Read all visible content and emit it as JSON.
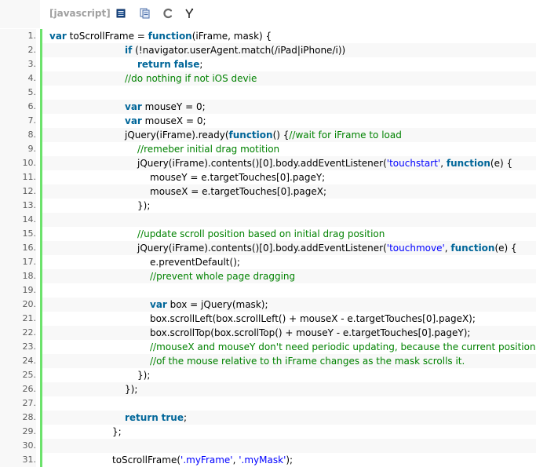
{
  "toolbar": {
    "language": "[javascript]",
    "icons": [
      "view-source-icon",
      "copy-icon",
      "print-icon",
      "about-icon"
    ]
  },
  "colors": {
    "keyword": "#006699",
    "string": "#0000ff",
    "comment": "#008200",
    "gutter_bar": "#6ce26c",
    "line_number": "#5c5c5c"
  },
  "code": {
    "lines": [
      {
        "num": "1.",
        "indent": 0,
        "tokens": [
          [
            "kw",
            "var"
          ],
          [
            "p",
            " toScrollFrame = "
          ],
          [
            "kw",
            "function"
          ],
          [
            "p",
            "(iFrame, mask) {"
          ]
        ]
      },
      {
        "num": "2.",
        "indent": 6,
        "tokens": [
          [
            "kw",
            "if"
          ],
          [
            "p",
            " (!navigator.userAgent.match(/iPad|iPhone/i))"
          ]
        ]
      },
      {
        "num": "3.",
        "indent": 7,
        "tokens": [
          [
            "kw",
            "return"
          ],
          [
            "p",
            " "
          ],
          [
            "kw",
            "false"
          ],
          [
            "p",
            ";"
          ]
        ]
      },
      {
        "num": "4.",
        "indent": 6,
        "tokens": [
          [
            "c",
            "//do nothing if not iOS devie"
          ]
        ]
      },
      {
        "num": "5.",
        "indent": 0,
        "tokens": []
      },
      {
        "num": "6.",
        "indent": 6,
        "tokens": [
          [
            "kw",
            "var"
          ],
          [
            "p",
            " mouseY = 0;"
          ]
        ]
      },
      {
        "num": "7.",
        "indent": 6,
        "tokens": [
          [
            "kw",
            "var"
          ],
          [
            "p",
            " mouseX = 0;"
          ]
        ]
      },
      {
        "num": "8.",
        "indent": 6,
        "tokens": [
          [
            "p",
            "jQuery(iFrame).ready("
          ],
          [
            "kw",
            "function"
          ],
          [
            "p",
            "() {"
          ],
          [
            "c",
            "//wait for iFrame to load"
          ]
        ]
      },
      {
        "num": "9.",
        "indent": 7,
        "tokens": [
          [
            "c",
            "//remeber initial drag motition"
          ]
        ]
      },
      {
        "num": "10.",
        "indent": 7,
        "tokens": [
          [
            "p",
            "jQuery(iFrame).contents()[0].body.addEventListener("
          ],
          [
            "s",
            "'touchstart'"
          ],
          [
            "p",
            ", "
          ],
          [
            "kw",
            "function"
          ],
          [
            "p",
            "(e) {"
          ]
        ]
      },
      {
        "num": "11.",
        "indent": 8,
        "tokens": [
          [
            "p",
            "mouseY = e.targetTouches[0].pageY;"
          ]
        ]
      },
      {
        "num": "12.",
        "indent": 8,
        "tokens": [
          [
            "p",
            "mouseX = e.targetTouches[0].pageX;"
          ]
        ]
      },
      {
        "num": "13.",
        "indent": 7,
        "tokens": [
          [
            "p",
            "});"
          ]
        ]
      },
      {
        "num": "14.",
        "indent": 0,
        "tokens": []
      },
      {
        "num": "15.",
        "indent": 7,
        "tokens": [
          [
            "c",
            "//update scroll position based on initial drag position"
          ]
        ]
      },
      {
        "num": "16.",
        "indent": 7,
        "tokens": [
          [
            "p",
            "jQuery(iFrame).contents()[0].body.addEventListener("
          ],
          [
            "s",
            "'touchmove'"
          ],
          [
            "p",
            ", "
          ],
          [
            "kw",
            "function"
          ],
          [
            "p",
            "(e) {"
          ]
        ]
      },
      {
        "num": "17.",
        "indent": 8,
        "tokens": [
          [
            "p",
            "e.preventDefault();"
          ]
        ]
      },
      {
        "num": "18.",
        "indent": 8,
        "tokens": [
          [
            "c",
            "//prevent whole page dragging"
          ]
        ]
      },
      {
        "num": "19.",
        "indent": 0,
        "tokens": []
      },
      {
        "num": "20.",
        "indent": 8,
        "tokens": [
          [
            "kw",
            "var"
          ],
          [
            "p",
            " box = jQuery(mask);"
          ]
        ]
      },
      {
        "num": "21.",
        "indent": 8,
        "tokens": [
          [
            "p",
            "box.scrollLeft(box.scrollLeft() + mouseX - e.targetTouches[0].pageX);"
          ]
        ]
      },
      {
        "num": "22.",
        "indent": 8,
        "tokens": [
          [
            "p",
            "box.scrollTop(box.scrollTop() + mouseY - e.targetTouches[0].pageY);"
          ]
        ]
      },
      {
        "num": "23.",
        "indent": 8,
        "tokens": [
          [
            "c",
            "//mouseX and mouseY don't need periodic updating, because the current position"
          ]
        ]
      },
      {
        "num": "24.",
        "indent": 8,
        "tokens": [
          [
            "c",
            "//of the mouse relative to th iFrame changes as the mask scrolls it."
          ]
        ]
      },
      {
        "num": "25.",
        "indent": 7,
        "tokens": [
          [
            "p",
            "});"
          ]
        ]
      },
      {
        "num": "26.",
        "indent": 6,
        "tokens": [
          [
            "p",
            "});"
          ]
        ]
      },
      {
        "num": "27.",
        "indent": 0,
        "tokens": []
      },
      {
        "num": "28.",
        "indent": 6,
        "tokens": [
          [
            "kw",
            "return"
          ],
          [
            "p",
            " "
          ],
          [
            "kw",
            "true"
          ],
          [
            "p",
            ";"
          ]
        ]
      },
      {
        "num": "29.",
        "indent": 5,
        "tokens": [
          [
            "p",
            "};"
          ]
        ]
      },
      {
        "num": "30.",
        "indent": 0,
        "tokens": []
      },
      {
        "num": "31.",
        "indent": 5,
        "tokens": [
          [
            "p",
            "toScrollFrame("
          ],
          [
            "s",
            "'.myFrame'"
          ],
          [
            "p",
            ", "
          ],
          [
            "s",
            "'.myMask'"
          ],
          [
            "p",
            ");"
          ]
        ]
      }
    ]
  }
}
